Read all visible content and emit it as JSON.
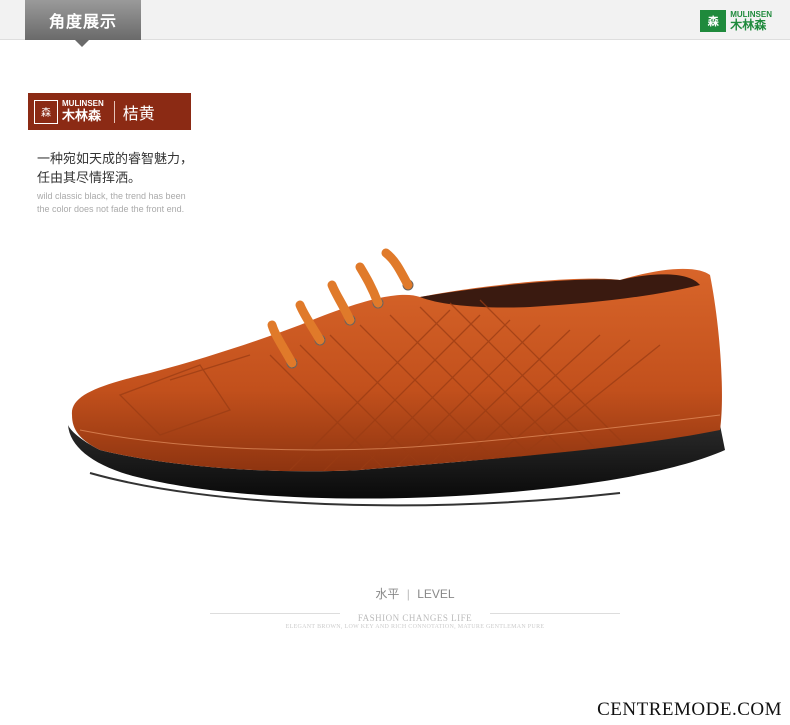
{
  "header": {
    "tab_label": "角度展示",
    "logo": {
      "en": "MULINSEN",
      "cn": "木林森",
      "mark": "森"
    }
  },
  "brand_badge": {
    "mark": "森",
    "en": "MULINSEN",
    "cn": "木林森",
    "color_name": "桔黄"
  },
  "tagline": {
    "line1": "一种宛如天成的睿智魅力，",
    "line2": "任由其尽情挥洒。",
    "en_line1": "wild classic black, the trend has been",
    "en_line2": "the color does not fade the front end."
  },
  "level": {
    "cn": "水平",
    "sep": "|",
    "en": "LEVEL",
    "subtitle": "FASHION CHANGES LIFE",
    "small": "ELEGANT BROWN, LOW KEY AND RICH CONNOTATION, MATURE GENTLEMAN PURE"
  },
  "watermark": "CENTREMODE.COM",
  "colors": {
    "leather": "#c8531f",
    "badge": "#8b2a14",
    "logo_green": "#1f8a3c"
  }
}
